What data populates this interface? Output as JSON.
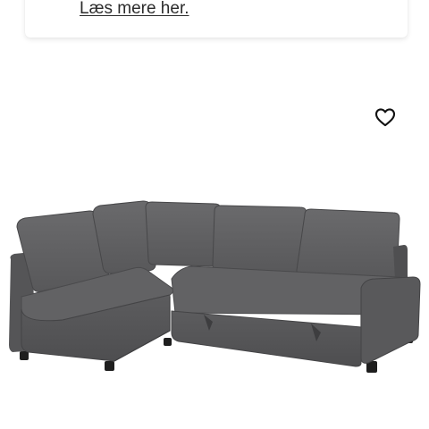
{
  "notice": {
    "link_label": "Læs mere her."
  },
  "product": {
    "favorite_icon": "heart-outline-icon",
    "image_icon": "corner-sofa-bed-photo",
    "sofa_color": "#5a5a5c"
  }
}
